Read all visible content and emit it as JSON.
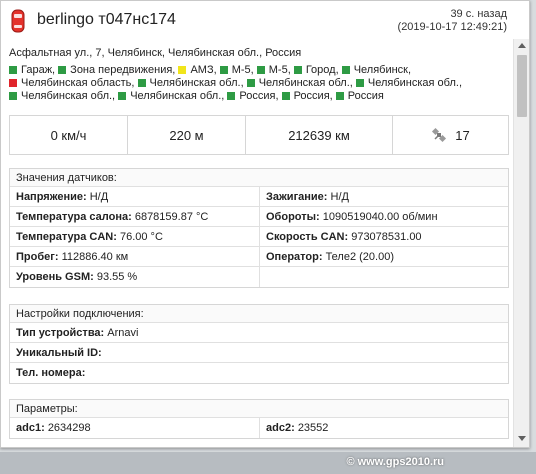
{
  "header": {
    "title": "berlingo т047нс174",
    "ago": "39 с. назад",
    "datetime": "(2019-10-17 12:49:21)"
  },
  "address": "Асфальтная ул., 7, Челябинск, Челябинская обл., Россия",
  "zones": [
    {
      "label": "Гараж,",
      "color": "#2e9b44"
    },
    {
      "label": "Зона передвижения,",
      "color": "#2e9b44"
    },
    {
      "label": "АМЗ,",
      "color": "#f1e51b"
    },
    {
      "label": "М-5,",
      "color": "#2e9b44"
    },
    {
      "label": "М-5,",
      "color": "#2e9b44"
    },
    {
      "label": "Город,",
      "color": "#2e9b44"
    },
    {
      "label": "Челябинск,",
      "color": "#2e9b44"
    },
    {
      "label": "Челябинская область,",
      "color": "#e0242b"
    },
    {
      "label": "Челябинская обл.,",
      "color": "#2e9b44"
    },
    {
      "label": "Челябинская обл.,",
      "color": "#2e9b44"
    },
    {
      "label": "Челябинская обл.,",
      "color": "#2e9b44"
    },
    {
      "label": "Челябинская обл.,",
      "color": "#2e9b44"
    },
    {
      "label": "Челябинская обл.,",
      "color": "#2e9b44"
    },
    {
      "label": "Россия,",
      "color": "#2e9b44"
    },
    {
      "label": "Россия,",
      "color": "#2e9b44"
    },
    {
      "label": "Россия",
      "color": "#2e9b44"
    }
  ],
  "stats": {
    "speed": "0 км/ч",
    "distance": "220 м",
    "mileage": "212639 км",
    "satellites": "17"
  },
  "sensors": {
    "title": "Значения датчиков:",
    "rows": [
      [
        {
          "k": "Напряжение:",
          "v": "Н/Д"
        },
        {
          "k": "Зажигание:",
          "v": "Н/Д"
        }
      ],
      [
        {
          "k": "Температура салона:",
          "v": "6878159.87 °C"
        },
        {
          "k": "Обороты:",
          "v": "1090519040.00 об/мин"
        }
      ],
      [
        {
          "k": "Температура CAN:",
          "v": "76.00 °C"
        },
        {
          "k": "Скорость CAN:",
          "v": "973078531.00"
        }
      ],
      [
        {
          "k": "Пробег:",
          "v": "112886.40 км"
        },
        {
          "k": "Оператор:",
          "v": "Теле2 (20.00)"
        }
      ],
      [
        {
          "k": "Уровень GSM:",
          "v": "93.55 %"
        },
        {
          "k": "",
          "v": ""
        }
      ]
    ]
  },
  "connection": {
    "title": "Настройки подключения:",
    "rows": [
      {
        "k": "Тип устройства:",
        "v": "Arnavi"
      },
      {
        "k": "Уникальный ID:",
        "v": ""
      },
      {
        "k": "Тел. номера:",
        "v": ""
      }
    ]
  },
  "params": {
    "title": "Параметры:",
    "rows": [
      [
        {
          "k": "adc1:",
          "v": "2634298"
        },
        {
          "k": "adc2:",
          "v": "23552"
        }
      ]
    ]
  },
  "footer": "© www.gps2010.ru"
}
